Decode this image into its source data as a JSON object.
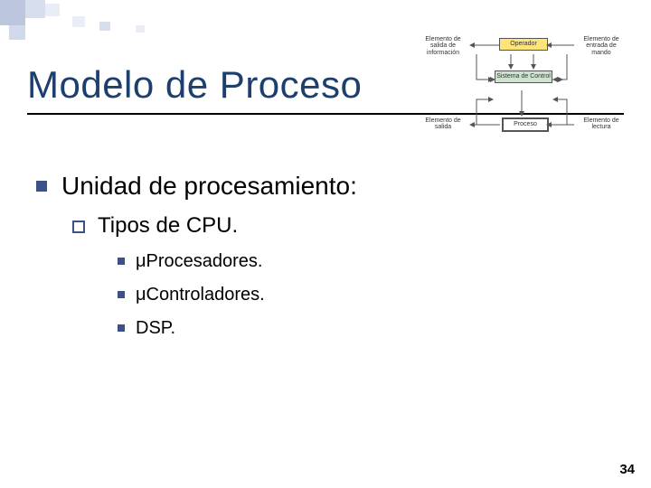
{
  "slide": {
    "title": "Modelo de Proceso",
    "page_number": "34"
  },
  "content": {
    "l1": "Unidad de procesamiento:",
    "l2": "Tipos de CPU.",
    "l3a": "μProcesadores.",
    "l3b": "μControladores.",
    "l3c": "DSP."
  },
  "diagram": {
    "box_operador": "Operador",
    "box_control": "Sistema de\nControl",
    "box_proceso": "Proceso",
    "lbl_tl": "Elemento de\nsalida de\ninformación",
    "lbl_tr": "Elemento de\nentrada de\nmando",
    "lbl_bl": "Elemento de\nsalida",
    "lbl_br": "Elemento de\nlectura"
  }
}
